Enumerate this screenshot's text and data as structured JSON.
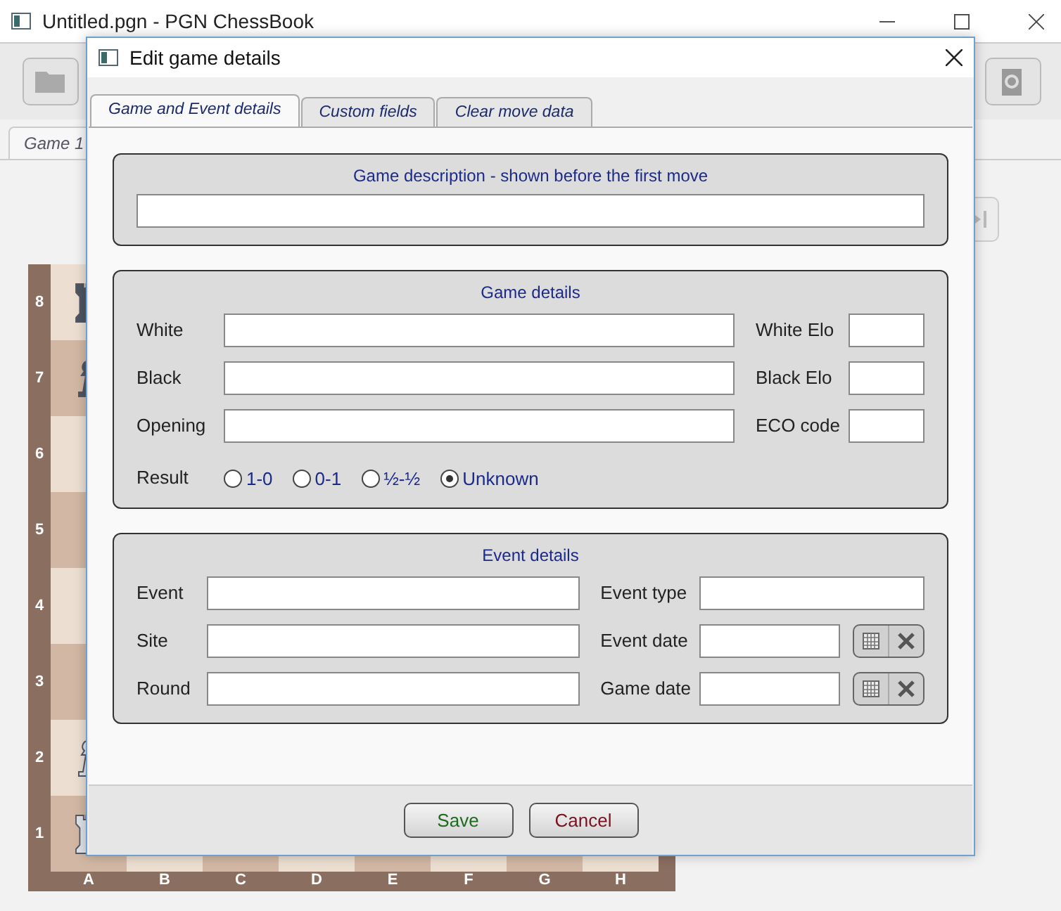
{
  "app_window": {
    "title": "Untitled.pgn - PGN ChessBook",
    "game_tab": "Game 1",
    "board": {
      "ranks": [
        "8",
        "7",
        "6",
        "5",
        "4",
        "3",
        "2",
        "1"
      ],
      "files": [
        "A",
        "B",
        "C",
        "D",
        "E",
        "F",
        "G",
        "H"
      ]
    }
  },
  "dialog": {
    "title": "Edit game details",
    "tabs": [
      {
        "label": "Game and Event details",
        "selected": true
      },
      {
        "label": "Custom fields",
        "selected": false
      },
      {
        "label": "Clear move data",
        "selected": false
      }
    ],
    "description_group": {
      "title": "Game description - shown before the first move"
    },
    "game_details": {
      "title": "Game details",
      "rows": [
        {
          "label": "White",
          "side_label": "White Elo"
        },
        {
          "label": "Black",
          "side_label": "Black Elo"
        },
        {
          "label": "Opening",
          "side_label": "ECO code"
        }
      ],
      "result": {
        "label": "Result",
        "options": [
          {
            "label": "1-0",
            "selected": false
          },
          {
            "label": "0-1",
            "selected": false
          },
          {
            "label": "½-½",
            "selected": false
          },
          {
            "label": "Unknown",
            "selected": true
          }
        ]
      }
    },
    "event_details": {
      "title": "Event details",
      "rows": [
        {
          "label": "Event",
          "side_label": "Event type",
          "kind": "text"
        },
        {
          "label": "Site",
          "side_label": "Event date",
          "kind": "date"
        },
        {
          "label": "Round",
          "side_label": "Game date",
          "kind": "date"
        }
      ]
    },
    "buttons": [
      {
        "label": "Save",
        "kind": "save"
      },
      {
        "label": "Cancel",
        "kind": "cancel"
      }
    ]
  }
}
